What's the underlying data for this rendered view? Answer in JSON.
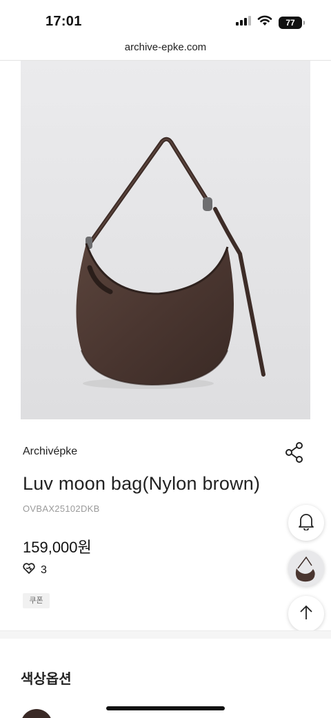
{
  "status_bar": {
    "time": "17:01",
    "battery": "77",
    "icons": [
      "signal-icon",
      "wifi-icon",
      "battery-icon"
    ]
  },
  "browser": {
    "url": "archive-epke.com"
  },
  "product": {
    "brand": "Archivépke",
    "name": "Luv moon bag(Nylon brown)",
    "code": "OVBAX25102DKB",
    "price": "159,000원",
    "likes": "3",
    "coupon_label": "쿠폰",
    "image_alt": "Luv moon bag brown nylon"
  },
  "actions": {
    "share_icon": "share-icon",
    "bell_icon": "bell-icon",
    "scroll_top_icon": "arrow-up-icon"
  },
  "options_section": {
    "title": "색상옵션"
  },
  "colors": {
    "bag": "#4a3630",
    "strap": "#3d2c27",
    "background": "#e6e6e8"
  }
}
